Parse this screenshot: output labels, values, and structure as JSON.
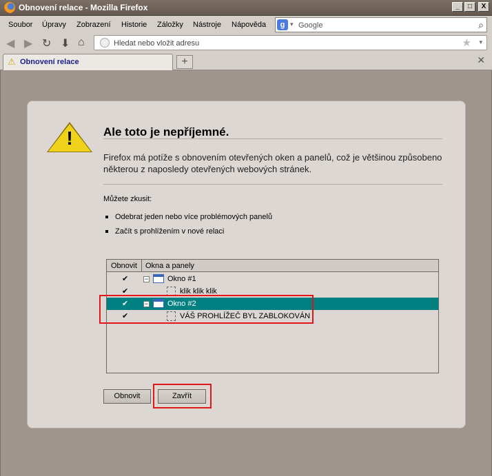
{
  "window": {
    "title": "Obnovení relace - Mozilla Firefox",
    "controls": {
      "minimize": "_",
      "maximize": "□",
      "close": "X"
    }
  },
  "menubar": {
    "items": [
      "Soubor",
      "Úpravy",
      "Zobrazení",
      "Historie",
      "Záložky",
      "Nástroje",
      "Nápověda"
    ]
  },
  "search": {
    "engine_icon": "g-icon",
    "placeholder": "Google"
  },
  "navigation": {
    "url_placeholder": "Hledat nebo vložit adresu",
    "icons": [
      "back-icon",
      "forward-icon",
      "reload-icon",
      "download-icon",
      "home-icon"
    ]
  },
  "tabs": [
    {
      "label": "Obnovení relace",
      "icon": "warning-icon",
      "active": true
    }
  ],
  "page": {
    "heading": "Ale toto je nepříjemné.",
    "description": "Firefox má potíže s obnovením otevřených oken a panelů, což je většinou způsobeno některou z naposledy otevřených webových stránek.",
    "suggestions_title": "Můžete zkusit:",
    "suggestions": [
      "Odebrat jeden nebo více problémových panelů",
      "Začít s prohlížením v nové relaci"
    ],
    "tree": {
      "columns": [
        "Obnovit",
        "Okna a panely"
      ],
      "rows": [
        {
          "checked": "✔",
          "type": "window",
          "expander": "−",
          "label": "Okno #1",
          "selected": false
        },
        {
          "checked": "✔",
          "type": "tab",
          "label": "klik klik klik",
          "selected": false
        },
        {
          "checked": "✔",
          "type": "window",
          "expander": "−",
          "label": "Okno #2",
          "selected": true
        },
        {
          "checked": "✔",
          "type": "tab",
          "label": "VÁŠ PROHLÍŽEČ BYL ZABLOKOVÁN",
          "selected": false
        }
      ]
    },
    "buttons": {
      "restore": "Obnovit",
      "close": "Zavřít"
    }
  }
}
